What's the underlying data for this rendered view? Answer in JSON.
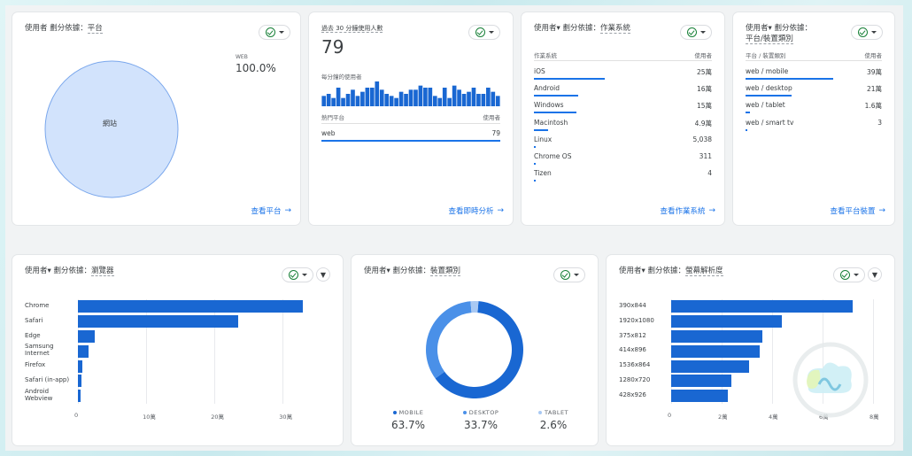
{
  "platform_card": {
    "title_prefix": "使用者 劃分依據：",
    "title_dim": "平台",
    "legend_label": "WEB",
    "legend_value": "100.0%",
    "pie_label": "網站",
    "link": "查看平台"
  },
  "realtime_card": {
    "title": "過去 30 分鐘使用人數",
    "value": "79",
    "subtitle": "每分鐘的使用者",
    "col_left": "熱門平台",
    "col_right": "使用者",
    "row_label": "web",
    "row_value": "79",
    "link": "查看即時分析",
    "minute_values": [
      5,
      6,
      4,
      9,
      4,
      6,
      8,
      5,
      7,
      9,
      9,
      12,
      8,
      6,
      5,
      4,
      7,
      6,
      8,
      8,
      10,
      9,
      9,
      5,
      4,
      9,
      4,
      10,
      8,
      6,
      7,
      9,
      6,
      6,
      9,
      7,
      5
    ]
  },
  "os_card": {
    "title_prefix": "使用者▾ 劃分依據：",
    "title_dim": "作業系統",
    "col_left": "作業系統",
    "col_right": "使用者",
    "rows": [
      {
        "label": "iOS",
        "value": "25萬",
        "frac": 0.4
      },
      {
        "label": "Android",
        "value": "16萬",
        "frac": 0.25
      },
      {
        "label": "Windows",
        "value": "15萬",
        "frac": 0.24
      },
      {
        "label": "Macintosh",
        "value": "4.9萬",
        "frac": 0.08
      },
      {
        "label": "Linux",
        "value": "5,038",
        "frac": 0.01
      },
      {
        "label": "Chrome OS",
        "value": "311",
        "frac": 0.0
      },
      {
        "label": "Tizen",
        "value": "4",
        "frac": 0.0
      }
    ],
    "link": "查看作業系統"
  },
  "device_card": {
    "title_line1_prefix": "使用者▾ 劃分依據：",
    "title_line2": "平台/裝置類別",
    "col_left": "平台 / 裝置類別",
    "col_right": "使用者",
    "rows": [
      {
        "label": "web / mobile",
        "value": "39萬",
        "frac": 0.64
      },
      {
        "label": "web / desktop",
        "value": "21萬",
        "frac": 0.34
      },
      {
        "label": "web / tablet",
        "value": "1.6萬",
        "frac": 0.03
      },
      {
        "label": "web / smart tv",
        "value": "3",
        "frac": 0.0
      }
    ],
    "link": "查看平台裝置"
  },
  "browser_card": {
    "title_prefix": "使用者▾ 劃分依據：",
    "title_dim": "瀏覽器",
    "x_ticks": [
      "0",
      "10萬",
      "20萬",
      "30萬"
    ]
  },
  "category_card": {
    "title_prefix": "使用者▾ 劃分依據：",
    "title_dim": "裝置類別",
    "legend": [
      {
        "label": "MOBILE",
        "value": "63.7%",
        "color": "#1967d2"
      },
      {
        "label": "DESKTOP",
        "value": "33.7%",
        "color": "#4a90e8"
      },
      {
        "label": "TABLET",
        "value": "2.6%",
        "color": "#a9c9f3"
      }
    ]
  },
  "resolution_card": {
    "title_prefix": "使用者▾ 劃分依據：",
    "title_dim": "螢幕解析度",
    "x_ticks": [
      "0",
      "2萬",
      "4萬",
      "6萬",
      "8萬"
    ]
  },
  "chart_data": [
    {
      "type": "pie",
      "categories": [
        "網站"
      ],
      "values": [
        100.0
      ]
    },
    {
      "type": "bar",
      "categories": [
        "Chrome",
        "Safari",
        "Edge",
        "Samsung Internet",
        "Firefox",
        "Safari (in-app)",
        "Android Webview"
      ],
      "values": [
        330000,
        235000,
        24000,
        15000,
        7000,
        5000,
        4000
      ],
      "xlim": [
        0,
        380000
      ]
    },
    {
      "type": "pie",
      "categories": [
        "MOBILE",
        "DESKTOP",
        "TABLET"
      ],
      "values": [
        63.7,
        33.7,
        2.6
      ]
    },
    {
      "type": "bar",
      "categories": [
        "390x844",
        "1920x1080",
        "375x812",
        "414x896",
        "1536x864",
        "1280x720",
        "428x926"
      ],
      "values": [
        72000,
        44000,
        36000,
        35000,
        31000,
        24000,
        22500
      ],
      "xlim": [
        0,
        80000
      ]
    }
  ]
}
